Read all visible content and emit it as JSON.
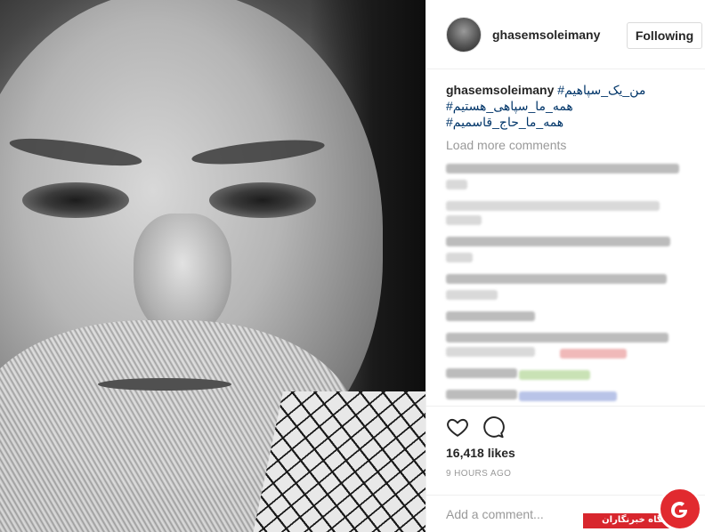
{
  "post": {
    "username": "ghasemsoleimany",
    "follow_label": "Following",
    "caption": {
      "user": "ghasemsoleimany",
      "lines": [
        "#من_یک_سپاهیم",
        "#همه_ما_سپاهی_هستیم",
        "#همه_ما_حاج_قاسمیم"
      ]
    },
    "load_more": "Load more comments",
    "likes": "16,418 likes",
    "time": "9 HOURS AGO",
    "add_comment_placeholder": "Add a comment..."
  },
  "watermark": {
    "label": "باشگاه خبرنگاران"
  },
  "colors": {
    "hashtag": "#003569",
    "muted": "#999999",
    "border": "#efefef",
    "watermark_red": "#d8262d"
  },
  "icons": {
    "like": "heart-outline-icon",
    "comment": "speech-bubble-icon"
  }
}
